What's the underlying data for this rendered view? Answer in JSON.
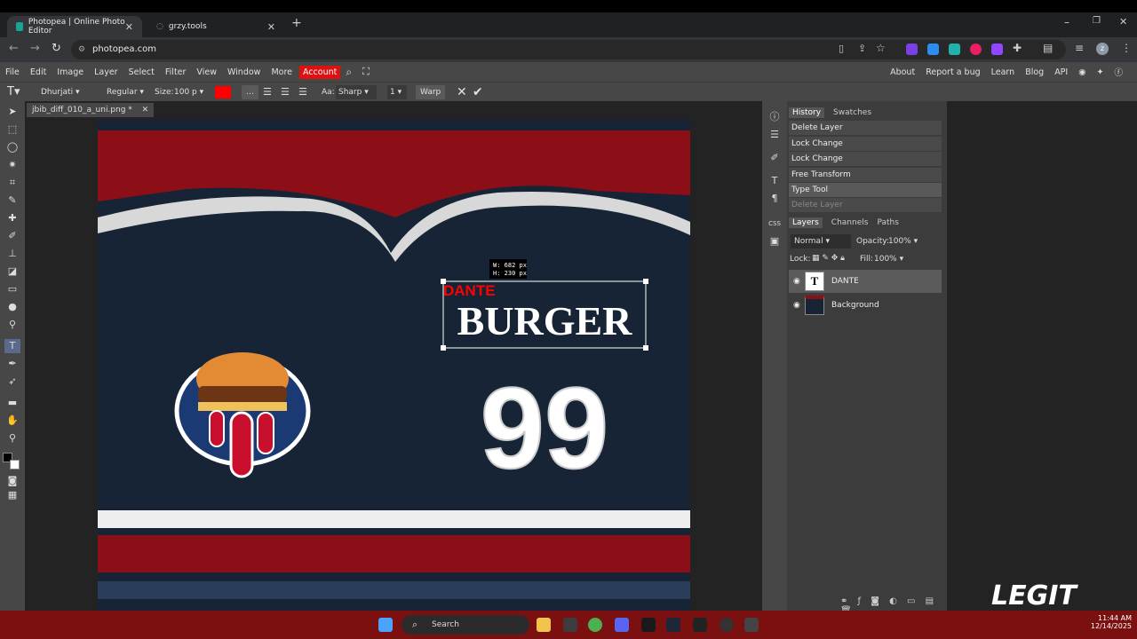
{
  "browser": {
    "tabs": [
      {
        "title": "Photopea | Online Photo Editor",
        "active": true
      },
      {
        "title": "grzy.tools",
        "active": false
      }
    ],
    "url": "photopea.com"
  },
  "menu": {
    "items": [
      "File",
      "Edit",
      "Image",
      "Layer",
      "Select",
      "Filter",
      "View",
      "Window",
      "More"
    ],
    "account": "Account",
    "right_links": [
      "About",
      "Report a bug",
      "Learn",
      "Blog",
      "API"
    ]
  },
  "options": {
    "font": "Dhurjati",
    "style": "Regular",
    "size_label": "Size:",
    "size_value": "100 p",
    "aa_label": "Aa:",
    "aa_value": "Sharp",
    "spacing_value": "1",
    "warp": "Warp",
    "color": "#ff0000"
  },
  "document": {
    "tab_title": "jbib_diff_010_a_uni.png *",
    "transform_w": "W: 682 px",
    "transform_h": "H: 230 px",
    "typed_text": "DANTE",
    "name_text": "BURGER",
    "number_text": "99"
  },
  "history": {
    "tabs": [
      "History",
      "Swatches"
    ],
    "items": [
      "Delete Layer",
      "Lock Change",
      "Lock Change",
      "Free Transform",
      "Type Tool",
      "Delete Layer"
    ]
  },
  "layers": {
    "tabs": [
      "Layers",
      "Channels",
      "Paths"
    ],
    "blend": "Normal",
    "opacity_label": "Opacity:",
    "opacity": "100%",
    "lock_label": "Lock:",
    "fill_label": "Fill:",
    "fill": "100%",
    "items": [
      {
        "name": "DANTE",
        "selected": true
      },
      {
        "name": "Background",
        "selected": false
      }
    ]
  },
  "taskbar": {
    "search": "Search",
    "time": "11:44 AM",
    "date": "12/14/2025"
  },
  "watermark": "LEGIT"
}
